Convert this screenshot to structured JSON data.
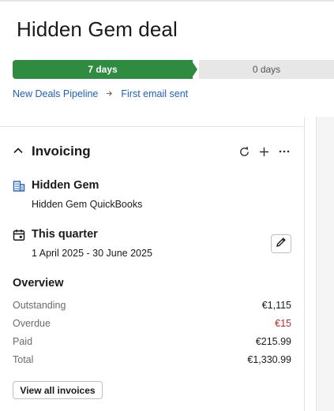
{
  "deal": {
    "title": "Hidden Gem deal"
  },
  "pipeline": {
    "stages": [
      {
        "label": "7 days",
        "status": "current"
      },
      {
        "label": "0 days",
        "status": "upcoming"
      }
    ],
    "breadcrumb": {
      "pipeline": "New Deals Pipeline",
      "stage": "First email sent"
    }
  },
  "invoicing": {
    "title": "Invoicing",
    "organization": {
      "name": "Hidden Gem",
      "integration": "Hidden Gem QuickBooks"
    },
    "period": {
      "title": "This quarter",
      "range": "1 April 2025 - 30 June 2025"
    },
    "overview": {
      "title": "Overview",
      "rows": [
        {
          "label": "Outstanding",
          "value": "€1,115"
        },
        {
          "label": "Overdue",
          "value": "€15"
        },
        {
          "label": "Paid",
          "value": "€215.99"
        },
        {
          "label": "Total",
          "value": "€1,330.99"
        }
      ]
    },
    "view_all_label": "View all invoices"
  },
  "colors": {
    "progress_done": "#2e8b3f",
    "link": "#1f5fbf",
    "overdue": "#c4262e"
  },
  "icons": [
    "chevron-up-icon",
    "refresh-icon",
    "plus-icon",
    "more-icon",
    "building-icon",
    "calendar-icon",
    "pencil-icon",
    "arrow-right-icon"
  ]
}
